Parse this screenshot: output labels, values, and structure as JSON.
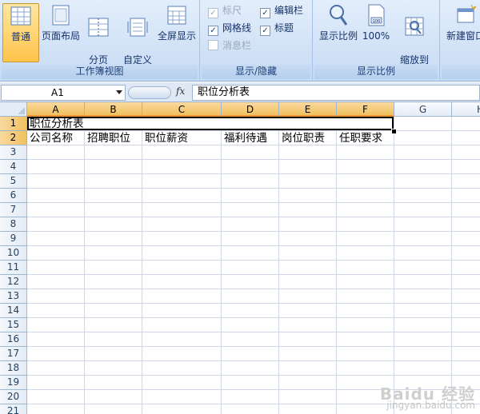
{
  "ribbon": {
    "workbook_views": {
      "label": "工作簿视图",
      "buttons": [
        {
          "label": "普通",
          "active": true,
          "icon": "normal-view-icon"
        },
        {
          "label": "页面布局",
          "icon": "page-layout-icon"
        },
        {
          "label": "分页\n预览",
          "icon": "page-break-preview-icon"
        },
        {
          "label": "自定义\n视图",
          "icon": "custom-views-icon"
        },
        {
          "label": "全屏显示",
          "icon": "full-screen-icon"
        }
      ]
    },
    "show_hide": {
      "label": "显示/隐藏",
      "items": [
        {
          "label": "标尺",
          "checked": true,
          "disabled": true
        },
        {
          "label": "网格线",
          "checked": true
        },
        {
          "label": "消息栏",
          "checked": false,
          "disabled": true
        },
        {
          "label": "编辑栏",
          "checked": true
        },
        {
          "label": "标题",
          "checked": true
        }
      ]
    },
    "zoom": {
      "label": "显示比例",
      "buttons": [
        {
          "label": "显示比例",
          "icon": "zoom-magnifier-icon"
        },
        {
          "label": "100%",
          "icon": "zoom-100-icon"
        },
        {
          "label": "缩放到\n选定区域",
          "icon": "zoom-to-selection-icon"
        }
      ]
    },
    "window": {
      "buttons": [
        {
          "label": "新建窗口",
          "icon": "new-window-icon"
        }
      ]
    }
  },
  "formula_bar": {
    "name_box": "A1",
    "fx": "fx",
    "content": "职位分析表"
  },
  "grid": {
    "columns": [
      "A",
      "B",
      "C",
      "D",
      "E",
      "F",
      "G",
      "H"
    ],
    "rows": [
      "1",
      "2",
      "3",
      "4",
      "5",
      "6",
      "7",
      "8",
      "9",
      "10",
      "11",
      "12",
      "13",
      "14",
      "15",
      "16",
      "17",
      "18",
      "19",
      "20",
      "21"
    ],
    "cells": {
      "A1": "职位分析表",
      "A2": "公司名称",
      "B2": "招聘职位",
      "C2": "职位薪资",
      "D2": "福利待遇",
      "E2": "岗位职责",
      "F2": "任职要求"
    }
  },
  "watermark": {
    "line1": "Baidu 经验",
    "line2": "jingyan.baidu.com"
  }
}
